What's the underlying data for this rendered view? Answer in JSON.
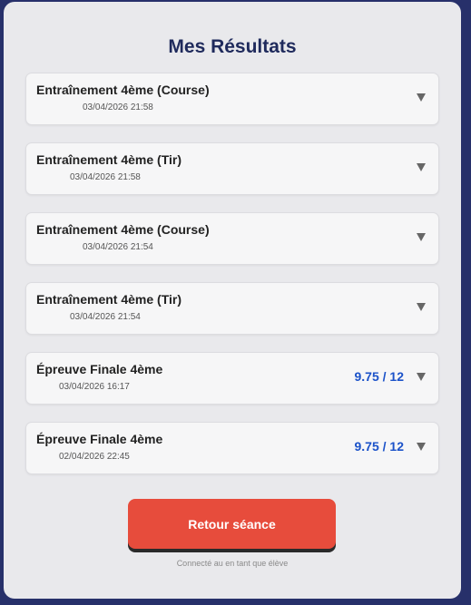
{
  "page": {
    "title": "Mes Résultats",
    "footer": "Connecté au en tant que élève"
  },
  "results": [
    {
      "title": "Entraînement 4ème (Course)",
      "date": "03/04/2026 21:58",
      "score": ""
    },
    {
      "title": "Entraînement 4ème (Tir)",
      "date": "03/04/2026 21:58",
      "score": ""
    },
    {
      "title": "Entraînement 4ème (Course)",
      "date": "03/04/2026 21:54",
      "score": ""
    },
    {
      "title": "Entraînement 4ème (Tir)",
      "date": "03/04/2026 21:54",
      "score": ""
    },
    {
      "title": "Épreuve Finale 4ème",
      "date": "03/04/2026 16:17",
      "score": "9.75 / 12"
    },
    {
      "title": "Épreuve Finale 4ème",
      "date": "02/04/2026 22:45",
      "score": "9.75 / 12"
    }
  ],
  "actions": {
    "back_label": "Retour séance"
  },
  "icons": {
    "expand": "chevron-down-icon"
  },
  "colors": {
    "background": "#27306a",
    "title": "#1f2a5c",
    "score": "#1b52c9",
    "button": "#e74c3c"
  }
}
